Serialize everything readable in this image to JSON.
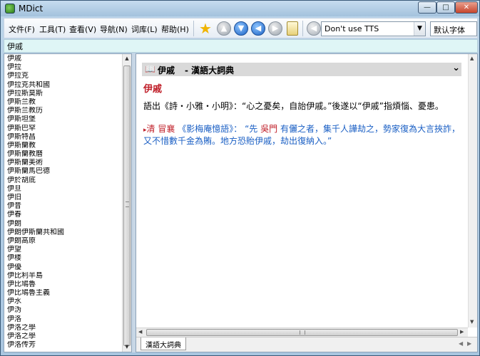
{
  "window": {
    "title": "MDict"
  },
  "menu": [
    {
      "label": "文件(F)"
    },
    {
      "label": "工具(T)"
    },
    {
      "label": "查看(V)"
    },
    {
      "label": "导航(N)"
    },
    {
      "label": "词库(L)"
    },
    {
      "label": "帮助(H)"
    }
  ],
  "toolbar": {
    "tts_select": "Don't use TTS",
    "font_select": "默认字体"
  },
  "search": {
    "value": "伊戚"
  },
  "word_list": [
    "伊戚",
    "伊拉",
    "伊拉克",
    "伊拉克共和國",
    "伊拉斯莫斯",
    "伊斯兰教",
    "伊斯兰教历",
    "伊斯坦堡",
    "伊斯巴罕",
    "伊斯特昌",
    "伊斯蘭教",
    "伊斯蘭教曆",
    "伊斯蘭美術",
    "伊斯蘭馬巴德",
    "伊於胡底",
    "伊旦",
    "伊旧",
    "伊昔",
    "伊春",
    "伊朗",
    "伊朗伊斯蘭共和國",
    "伊朗高原",
    "伊望",
    "伊楼",
    "伊優",
    "伊比利半島",
    "伊比鳩魯",
    "伊比鳩魯主義",
    "伊水",
    "伊沩",
    "伊洛",
    "伊洛之學",
    "伊洛之學",
    "伊洛传芳"
  ],
  "entry": {
    "headword": "伊戚",
    "dictionary": " - 漢語大詞典",
    "title": "伊戚",
    "definition": "語出《詩・小雅・小明》：“心之憂矣，自詒伊戚。”後遂以“伊戚”指煩惱、憂患。",
    "example": {
      "marker": "▸",
      "dynasty": "清",
      "author": "冒襄",
      "source": "《影梅庵憶語》：",
      "quote_start": "“先",
      "place": "吳門",
      "quote_rest": "有儷之者，集千人譁劫之，勢家復為大言挾詐，又不惜數千金為賄。地方恐貽伊戚，劫出復納入。”"
    }
  },
  "tabs": [
    {
      "label": "漢語大詞典"
    }
  ]
}
